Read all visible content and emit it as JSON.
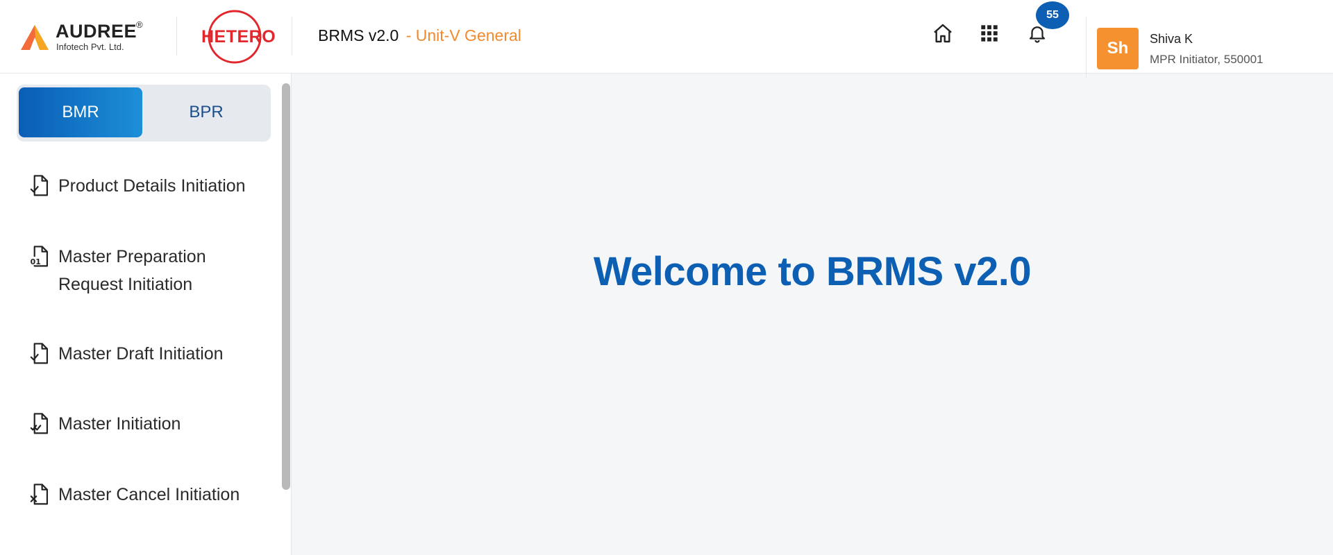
{
  "header": {
    "audree_logo": {
      "name": "AUDREE",
      "registered": "®",
      "subtitle": "Infotech Pvt. Ltd."
    },
    "hetero_logo": {
      "text": "HETERO"
    },
    "app_name": "BRMS v2.0",
    "unit": "- Unit-V General",
    "icons": {
      "home": "home-icon",
      "apps": "apps-grid-icon",
      "notifications": "bell-icon"
    },
    "notification_count": "55",
    "user": {
      "initials": "Sh",
      "name": "Shiva K",
      "role": "MPR Initiator, 550001"
    }
  },
  "sidebar": {
    "tabs": [
      {
        "label": "BMR",
        "active": true
      },
      {
        "label": "BPR",
        "active": false
      }
    ],
    "items": [
      {
        "label": "Product Details Initiation",
        "icon": "file-check-icon"
      },
      {
        "label": "Master Preparation Request Initiation",
        "icon": "file-binary-icon"
      },
      {
        "label": "Master Draft Initiation",
        "icon": "file-check-icon"
      },
      {
        "label": "Master Initiation",
        "icon": "file-double-check-icon"
      },
      {
        "label": "Master Cancel Initiation",
        "icon": "file-x-icon"
      }
    ]
  },
  "main": {
    "welcome": "Welcome to BRMS v2.0"
  },
  "colors": {
    "primary": "#0c5fb2",
    "accent": "#f28a2d",
    "avatar": "#f5922f",
    "hetero_red": "#e1262c"
  }
}
